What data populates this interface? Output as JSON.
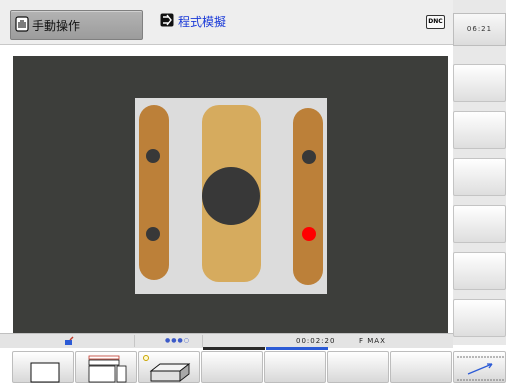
{
  "header": {
    "modes": [
      {
        "label": "手動操作",
        "icon": "hand-icon",
        "active": true
      },
      {
        "label": "程式模擬",
        "icon": "program-arrow-icon",
        "active": false
      }
    ],
    "dnc_label": "DNC"
  },
  "side_panel": {
    "clock": "06:21",
    "softkey_count": 6
  },
  "status": {
    "machine_icon": "machine-status-icon",
    "progress_dots": "●●●○",
    "timer": "00:02:20",
    "feed": "F MAX"
  },
  "colors": {
    "workpiece_bg": "#dcdcdc",
    "pocket_dark": "#bc8039",
    "pocket_light": "#d6ab5e",
    "hole": "#383838",
    "marker": "#ff0000",
    "viewport_bg": "#3d3e3b",
    "accent": "#2c5bd6"
  },
  "softkeys": [
    {
      "name": "view-plan-softkey",
      "icon": "plan-view-icon"
    },
    {
      "name": "view-three-planes-softkey",
      "icon": "three-planes-icon"
    },
    {
      "name": "view-3d-softkey",
      "icon": "3d-view-icon"
    },
    {
      "name": "softkey-4",
      "icon": ""
    },
    {
      "name": "softkey-5",
      "icon": ""
    },
    {
      "name": "softkey-6",
      "icon": ""
    },
    {
      "name": "softkey-7",
      "icon": ""
    },
    {
      "name": "next-softkey-row",
      "icon": "next-row-arrow-icon"
    }
  ]
}
